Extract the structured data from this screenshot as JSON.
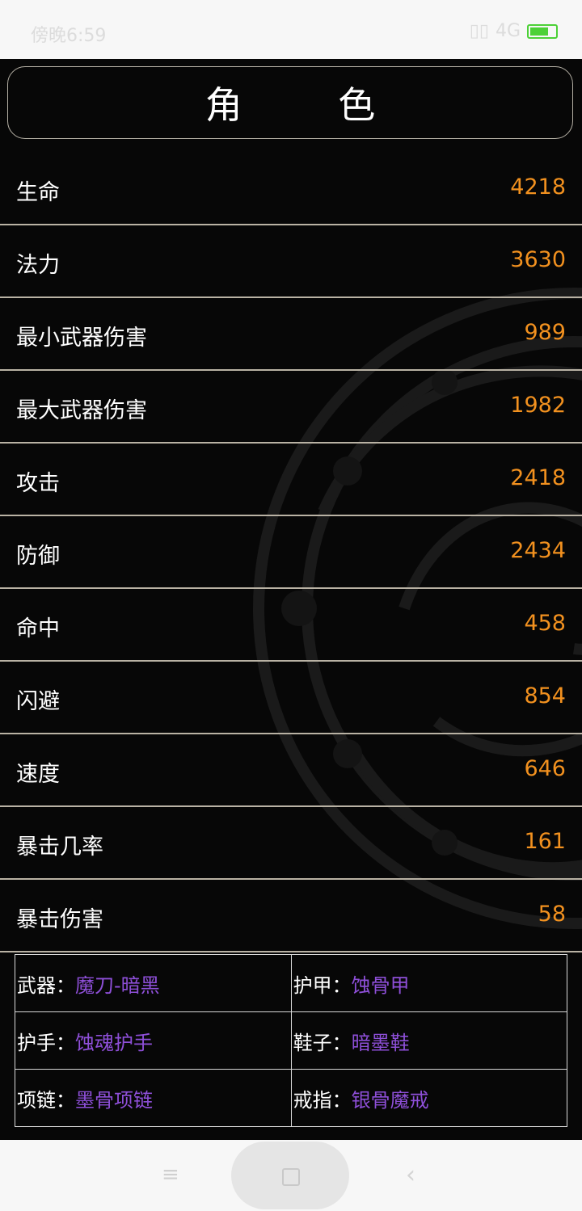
{
  "status_bar": {
    "time": "傍晚6:59",
    "network": "4G"
  },
  "header": {
    "title": "角 色"
  },
  "stats": [
    {
      "label": "生命",
      "value": "4218"
    },
    {
      "label": "法力",
      "value": "3630"
    },
    {
      "label": "最小武器伤害",
      "value": "989"
    },
    {
      "label": "最大武器伤害",
      "value": "1982"
    },
    {
      "label": "攻击",
      "value": "2418"
    },
    {
      "label": "防御",
      "value": "2434"
    },
    {
      "label": "命中",
      "value": "458"
    },
    {
      "label": "闪避",
      "value": "854"
    },
    {
      "label": "速度",
      "value": "646"
    },
    {
      "label": "暴击几率",
      "value": "161"
    },
    {
      "label": "暴击伤害",
      "value": "58"
    }
  ],
  "equipment": [
    {
      "slot": "武器：",
      "item": "魔刀-暗黑"
    },
    {
      "slot": "护甲：",
      "item": "蚀骨甲"
    },
    {
      "slot": "护手：",
      "item": "蚀魂护手"
    },
    {
      "slot": "鞋子：",
      "item": "暗墨鞋"
    },
    {
      "slot": "项链：",
      "item": "墨骨项链"
    },
    {
      "slot": "戒指：",
      "item": "银骨魔戒"
    }
  ],
  "colors": {
    "value": "#f2911f",
    "item": "#8e4fd8",
    "divider": "#b9b2a4"
  }
}
